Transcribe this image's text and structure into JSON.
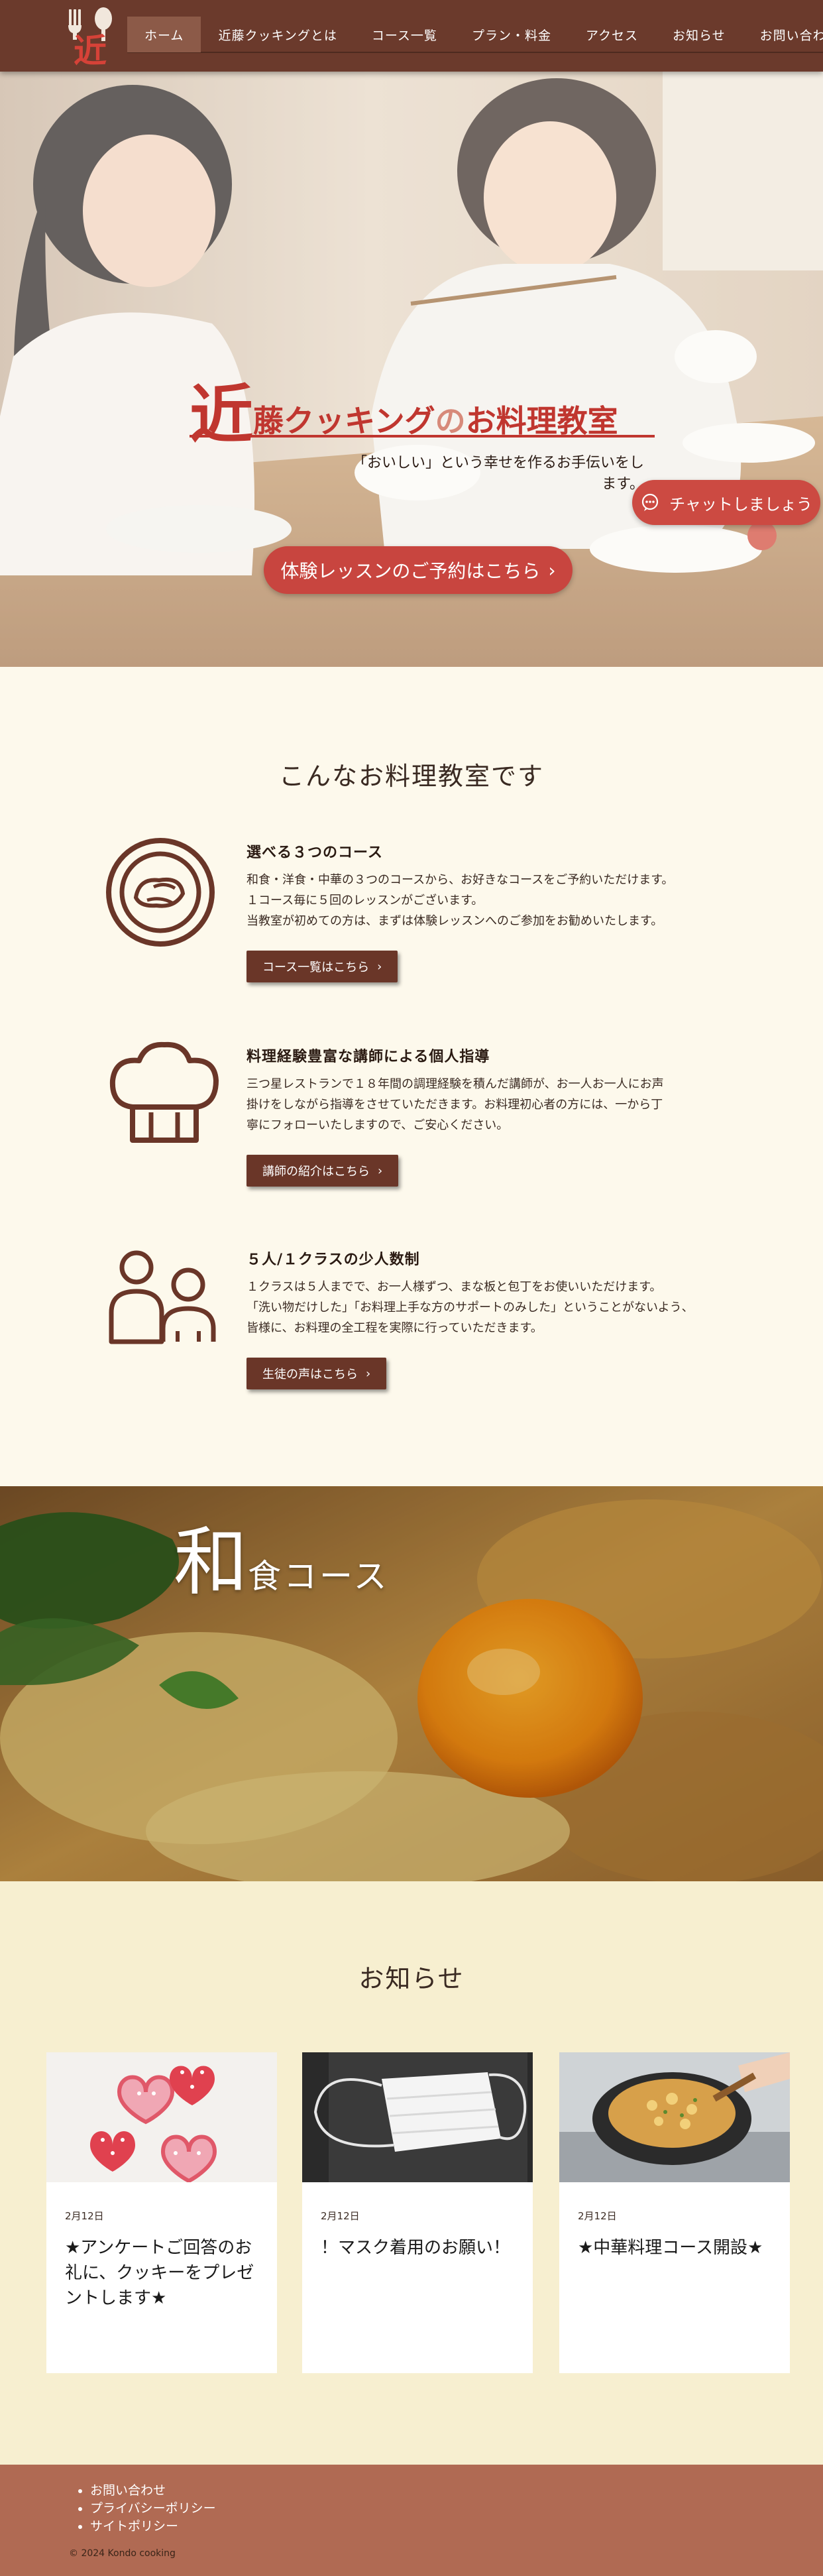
{
  "brand": {
    "logo_char": "近"
  },
  "nav": {
    "items": [
      "ホーム",
      "近藤クッキングとは",
      "コース一覧",
      "プラン・料金",
      "アクセス",
      "お知らせ",
      "お問い合わせ"
    ],
    "active_index": 0
  },
  "hero": {
    "title_big": "近",
    "title_part1": "藤クッキング",
    "title_no": "の",
    "title_part2": "お料理教室",
    "subtitle": "「おいしい」という幸せを作るお手伝いをします。",
    "chat_label": "チャットしましょう",
    "trial_label": "体験レッスンのご予約はこちら",
    "trial_arrow": "›"
  },
  "about": {
    "title": "こんなお料理教室です",
    "features": [
      {
        "icon": "plate-icon",
        "title": "選べる３つのコース",
        "lines": [
          "和食・洋食・中華の３つのコースから、お好きなコースをご予約いただけます。",
          "１コース毎に５回のレッスンがございます。",
          "当教室が初めての方は、まずは体験レッスンへのご参加をお勧めいたします。"
        ],
        "button": "コース一覧はこちら",
        "arrow": "›"
      },
      {
        "icon": "chef-hat-icon",
        "title": "料理経験豊富な講師による個人指導",
        "lines": [
          "三つ星レストランで１８年間の調理経験を積んだ講師が、お一人お一人にお声",
          "掛けをしながら指導をさせていただきます。お料理初心者の方には、一から丁",
          "寧にフォローいたしますので、ご安心ください。"
        ],
        "button": "講師の紹介はこちら",
        "arrow": "›"
      },
      {
        "icon": "people-icon",
        "title": "５人/１クラスの少人数制",
        "lines": [
          "１クラスは５人までで、お一人様ずつ、まな板と包丁をお使いいただけます。",
          "「洗い物だけした」「お料理上手な方のサポートのみした」ということがないよう、",
          "皆様に、お料理の全工程を実際に行っていただきます。"
        ],
        "button": "生徒の声はこちら",
        "arrow": "›"
      }
    ]
  },
  "banner": {
    "kanji": "和",
    "rest": "食コース"
  },
  "news": {
    "title": "お知らせ",
    "items": [
      {
        "date": "2月12日",
        "title": "★アンケートご回答のお礼に、クッキーをプレゼントします★",
        "thumb": "cookies-image"
      },
      {
        "date": "2月12日",
        "title": "！マスク着用のお願い！",
        "thumb": "mask-image"
      },
      {
        "date": "2月12日",
        "title": "★中華料理コース開設★",
        "thumb": "fried-rice-image"
      }
    ]
  },
  "footer": {
    "links": [
      "お問い合わせ",
      "プライバシーポリシー",
      "サイトポリシー"
    ],
    "copyright": "© 2024 Kondo cooking"
  },
  "colors": {
    "header": "#6b3a2c",
    "accent": "#c0362f",
    "button_red": "#c8453f",
    "small_button": "#6a3628",
    "page_bg": "#fdf9ec",
    "news_bg": "#f7efd0",
    "footer": "#b06a53"
  }
}
